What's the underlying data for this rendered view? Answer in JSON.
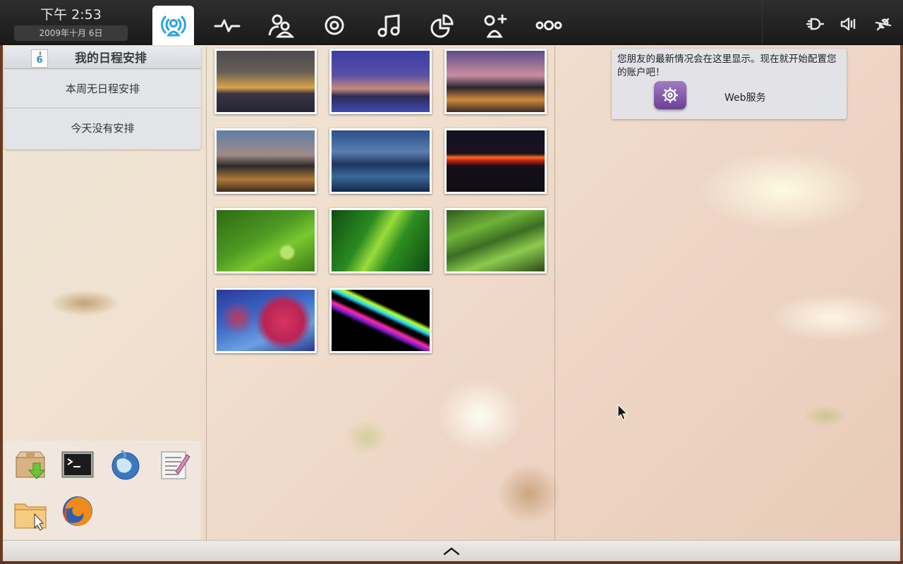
{
  "clock": {
    "time": "下午  2:53",
    "date": "2009年十月 6日"
  },
  "nav": {
    "items": [
      {
        "name": "status",
        "icon": "broadcast-person-icon",
        "active": true
      },
      {
        "name": "activity",
        "icon": "pulse-icon",
        "active": false
      },
      {
        "name": "people",
        "icon": "people-icon",
        "active": false
      },
      {
        "name": "zones",
        "icon": "target-icon",
        "active": false
      },
      {
        "name": "music",
        "icon": "music-note-icon",
        "active": false
      },
      {
        "name": "pasteboard",
        "icon": "pie-chart-icon",
        "active": false
      },
      {
        "name": "add-contact",
        "icon": "add-person-icon",
        "active": false
      },
      {
        "name": "applications",
        "icon": "dots-icon",
        "active": false
      }
    ]
  },
  "tray": {
    "icons": [
      "power-plug-icon",
      "volume-icon",
      "network-disconnected-icon"
    ]
  },
  "calendar": {
    "day": "6",
    "title": "我的日程安排",
    "week_text": "本周无日程安排",
    "today_text": "今天没有安排"
  },
  "launcher": {
    "items": [
      "package-download-icon",
      "terminal-icon",
      "web-globe-icon",
      "text-editor-icon",
      "file-manager-icon",
      "firefox-icon"
    ]
  },
  "gallery": {
    "count": 11,
    "items": [
      "city-night-skyline",
      "city-skyline-dusk",
      "downtown-towers-dusk",
      "city-skyline-evening",
      "harbor-city-night",
      "red-horizon-night",
      "green-leaf-droplet",
      "green-fern",
      "pine-branches",
      "red-maple-leaves",
      "colorful-light-streaks"
    ]
  },
  "web_services": {
    "message": "您朋友的最新情况会在这里显示。现在就开始配置您的账户吧！",
    "label": "Web服务",
    "icon": "web-services-icon"
  },
  "bottom_bar": {
    "icon": "expand-up-icon"
  },
  "colors": {
    "panel_bg": "#1e1e1e",
    "accent": "#29a3df",
    "widget_bg": "#e2e4e8"
  }
}
